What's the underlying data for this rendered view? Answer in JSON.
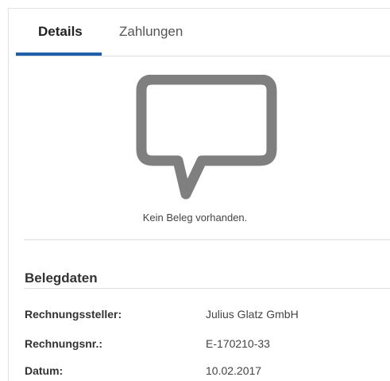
{
  "tabs": {
    "details": "Details",
    "zahlungen": "Zahlungen"
  },
  "empty_state": {
    "icon": "speech-bubble-icon",
    "message": "Kein Beleg vorhanden."
  },
  "belegdaten": {
    "title": "Belegdaten",
    "rows": [
      {
        "label": "Rechnungssteller:",
        "value": "Julius Glatz GmbH"
      },
      {
        "label": "Rechnungsnr.:",
        "value": "E-170210-33"
      },
      {
        "label": "Datum:",
        "value": "10.02.2017"
      }
    ]
  },
  "colors": {
    "accent": "#1f5fa8",
    "icon": "#7f7f7f"
  }
}
